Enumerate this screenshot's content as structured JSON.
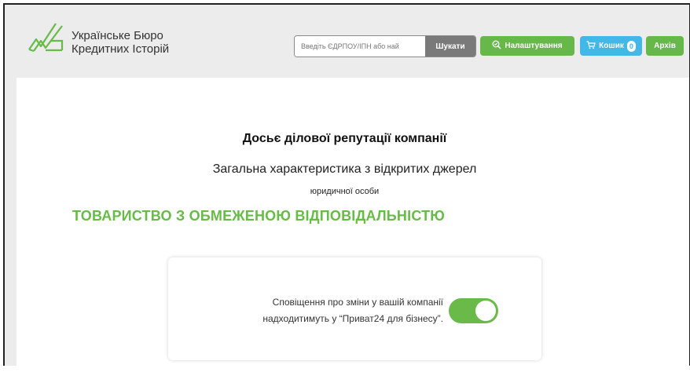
{
  "brand": {
    "line1": "Українське Бюро",
    "line2": "Кредитних Історій"
  },
  "search": {
    "placeholder": "Введіть ЄДРПОУ/ІПН або най",
    "button_label": "Шукати"
  },
  "header_buttons": {
    "settings_label": "Налаштування",
    "cart_label": "Кошик",
    "cart_count": "0",
    "archive_label": "Архів"
  },
  "report": {
    "title": "Досьє ділової репутації компанії",
    "subtitle": "Загальна характеристика з відкритих джерел",
    "entity_type": "юридичної особи",
    "company_name": "ТОВАРИСТВО З ОБМЕЖЕНОЮ ВІДПОВІДАЛЬНІСТЮ"
  },
  "notification": {
    "line1": "Сповіщення про зміни у вашій компанії",
    "line2": "надходитимуть у “Приват24 для бізнесу”.",
    "enabled": true
  },
  "colors": {
    "brand_green": "#66b848",
    "cart_blue": "#42b7e8",
    "search_gray": "#7a7a7a",
    "company_green": "#67bb47"
  }
}
